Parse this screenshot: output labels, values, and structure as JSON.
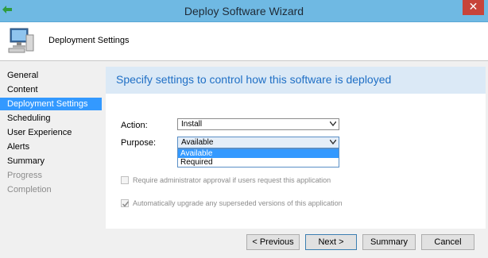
{
  "window": {
    "title": "Deploy Software Wizard"
  },
  "header": {
    "title": "Deployment Settings"
  },
  "nav": {
    "items": [
      {
        "label": "General"
      },
      {
        "label": "Content"
      },
      {
        "label": "Deployment Settings"
      },
      {
        "label": "Scheduling"
      },
      {
        "label": "User Experience"
      },
      {
        "label": "Alerts"
      },
      {
        "label": "Summary"
      },
      {
        "label": "Progress"
      },
      {
        "label": "Completion"
      }
    ],
    "selected": "Deployment Settings"
  },
  "main": {
    "heading": "Specify settings to control how this software is deployed",
    "action": {
      "label": "Action:",
      "value": "Install"
    },
    "purpose": {
      "label": "Purpose:",
      "value": "Available",
      "options": [
        "Available",
        "Required"
      ],
      "highlighted": "Available"
    },
    "require_approval": {
      "label": "Require administrator approval if users request this application",
      "checked": false,
      "enabled": false
    },
    "auto_upgrade": {
      "label": "Automatically upgrade any superseded versions of this application",
      "checked": true,
      "enabled": false
    }
  },
  "buttons": {
    "previous": "< Previous",
    "next": "Next >",
    "summary": "Summary",
    "cancel": "Cancel"
  },
  "colors": {
    "titlebar": "#6fb9e3",
    "selection": "#3399ff",
    "heading": "#1f6fc5",
    "banner": "#dbe9f6",
    "close": "#c7443a"
  },
  "icons": [
    "back-arrow-icon",
    "close-icon",
    "computer-icon",
    "chevron-down-icon",
    "checkmark-icon"
  ]
}
